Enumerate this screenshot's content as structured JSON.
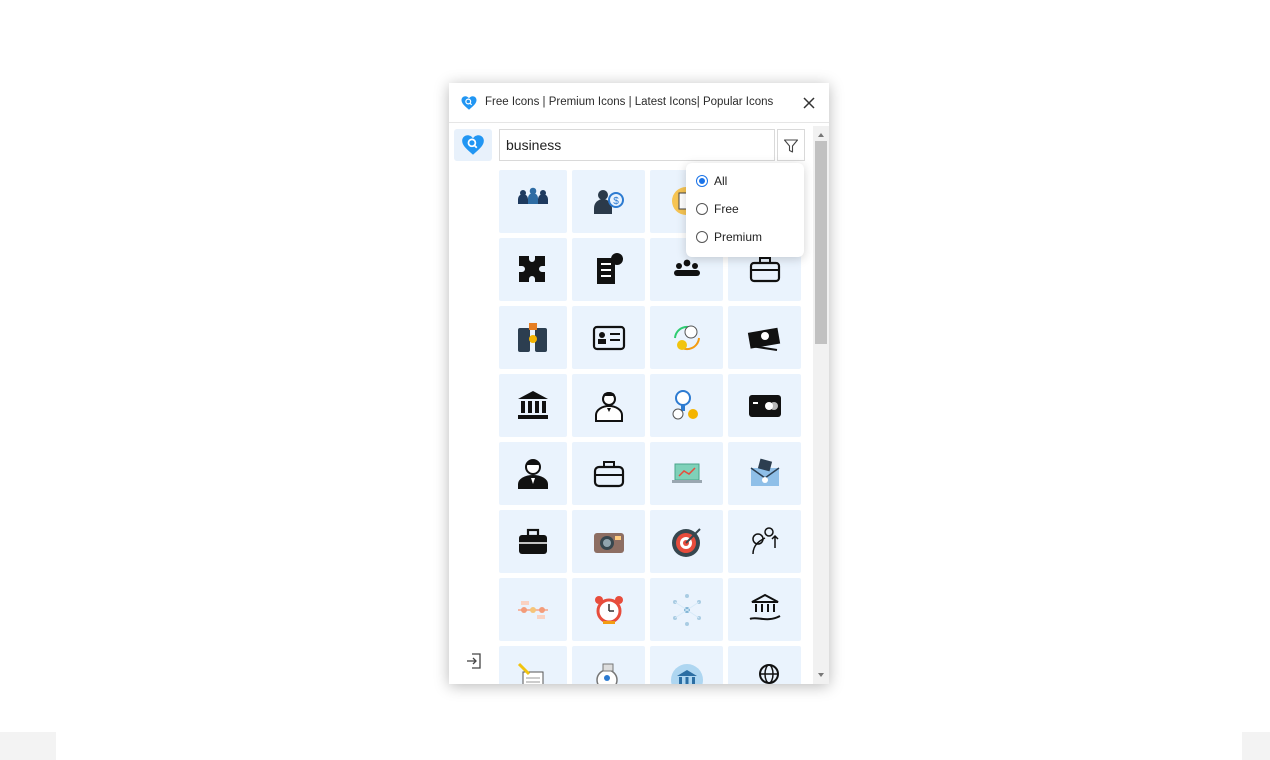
{
  "header": {
    "title": "Free Icons | Premium Icons | Latest Icons| Popular Icons",
    "close_icon": "close-icon"
  },
  "search": {
    "value": "business"
  },
  "filter": {
    "icon": "funnel-icon",
    "options": [
      {
        "label": "All",
        "selected": true
      },
      {
        "label": "Free",
        "selected": false
      },
      {
        "label": "Premium",
        "selected": false
      }
    ]
  },
  "sidebar": {
    "logo_icon": "heart-search-logo-icon",
    "logout_icon": "logout-icon"
  },
  "results": {
    "rows": [
      [
        "team-icon",
        "money-bag-person-icon",
        "document-coin-icon",
        "hidden-by-dropdown"
      ],
      [
        "puzzle-icon",
        "checklist-clock-icon",
        "group-people-icon",
        "briefcase-outline-icon"
      ],
      [
        "mobile-transfer-icon",
        "id-card-icon",
        "cycle-clock-coins-icon",
        "money-bills-icon"
      ],
      [
        "bank-icon",
        "businessman-icon",
        "idea-coins-icon",
        "credit-card-icon"
      ],
      [
        "man-portrait-icon",
        "briefcase-icon",
        "laptop-chart-icon",
        "envelope-money-icon"
      ],
      [
        "briefcase-solid-icon",
        "camera-icon",
        "target-icon",
        "growth-plant-icon"
      ],
      [
        "timeline-icon",
        "alarm-clock-icon",
        "network-icon",
        "hand-bank-icon"
      ],
      [
        "contract-pen-icon",
        "search-person-icon",
        "bank-circle-icon",
        "globe-hand-icon"
      ]
    ]
  },
  "colors": {
    "accent": "#1a73e8",
    "tile_bg": "#eaf3fd",
    "logo_blue": "#2196f3"
  }
}
